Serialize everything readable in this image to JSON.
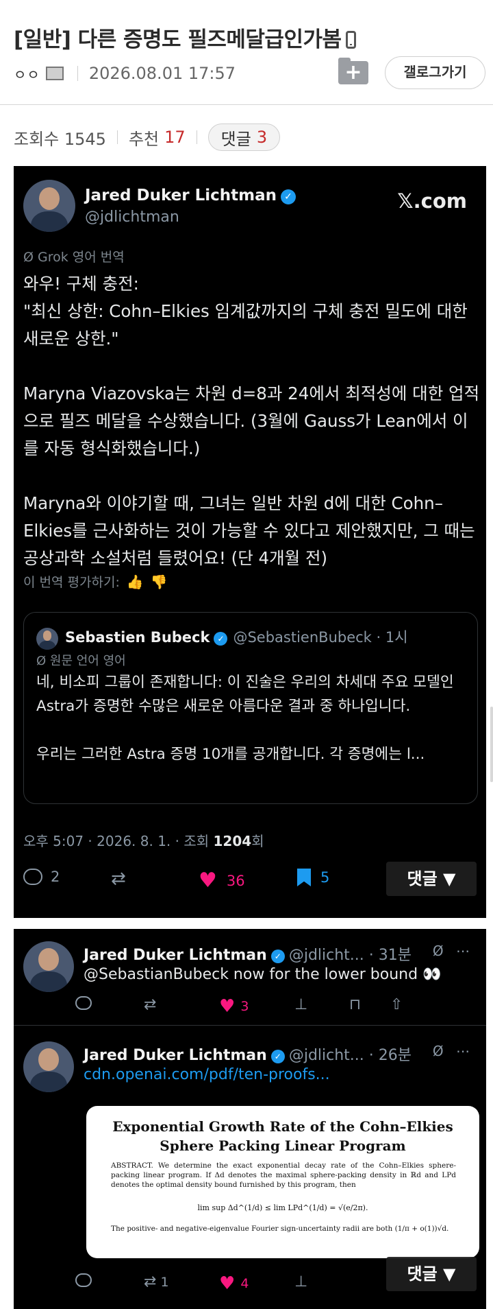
{
  "post": {
    "title": "[일반] 다른 증명도 필즈메달급인가봄",
    "author": "ㅇㅇ",
    "datetime": "2026.08.01 17:57",
    "gallery_button": "갤로그가기",
    "folder_icon": "+",
    "views_label": "조회수 1545",
    "likes_label": "추천",
    "likes_count": "17",
    "comments_label": "댓글",
    "comments_count": "3"
  },
  "tweet": {
    "name": "Jared Duker Lichtman",
    "handle": "@jdlichtman",
    "brand": "𝕏.com",
    "translation_note": "Ø Grok 영어 번역",
    "body": "와우! 구체 충전:\n\"최신 상한: Cohn–Elkies 임계값까지의 구체 충전 밀도에 대한 새로운 상한.\"\n\nMaryna Viazovska는 차원 d=8과 24에서 최적성에 대한 업적으로 필즈 메달을 수상했습니다. (3월에 Gauss가 Lean에서 이를 자동 형식화했습니다.)\n\nMaryna와 이야기할 때, 그녀는 일반 차원 d에 대한 Cohn–Elkies를 근사화하는 것이 가능할 수 있다고 제안했지만, 그 때는 공상과학 소설처럼 들렸어요! (단 4개월 전)",
    "rate_label": "이 번역 평가하기:",
    "time_prefix": "오후 5:07 · 2026. 8. 1. · 조회 ",
    "views": "1204",
    "views_suffix": "회",
    "replies": "2",
    "likes": "36",
    "bookmarks": "5"
  },
  "quote": {
    "name": "Sebastien Bubeck",
    "handle_time": "@SebastienBubeck · 1시",
    "orig_note": "Ø 원문 언어 영어",
    "body": "네, 비소피 그룹이 존재합니다: 이 진술은 우리의 차세대 주요 모델인 Astra가 증명한 수많은 새로운 아름다운 결과 중 하나입니다.\n\n우리는 그러한 Astra 증명 10개를 공개합니다. 각 증명에는 l..."
  },
  "float_comment_label": "댓글 ▼",
  "replies": [
    {
      "name": "Jared Duker Lichtman",
      "meta": "@jdlicht... · 31분",
      "text": "@SebastianBubeck now for the lower bound 👀",
      "likes": "3"
    },
    {
      "name": "Jared Duker Lichtman",
      "meta": "@jdlicht... · 26분",
      "link": "cdn.openai.com/pdf/ten-proofs...",
      "retweets": "1",
      "likes": "4"
    }
  ],
  "paper": {
    "title_line1": "Exponential Growth Rate of the Cohn–Elkies",
    "title_line2": "Sphere Packing Linear Program",
    "abstract": "ABSTRACT. We determine the exact exponential decay rate of the Cohn–Elkies sphere-packing linear program. If Δd denotes the maximal sphere-packing density in ℝd and LPd denotes the optimal density bound furnished by this program, then",
    "formula": "lim sup Δd^(1/d) ≤ lim LPd^(1/d) = √(e/2π).",
    "tail": "The positive- and negative-eigenvalue Fourier sign-uncertainty radii are both (1/π + o(1))√d."
  },
  "colors": {
    "like_pink": "#f91880",
    "x_blue": "#1d9bf0",
    "count_red": "#c62a2a"
  }
}
